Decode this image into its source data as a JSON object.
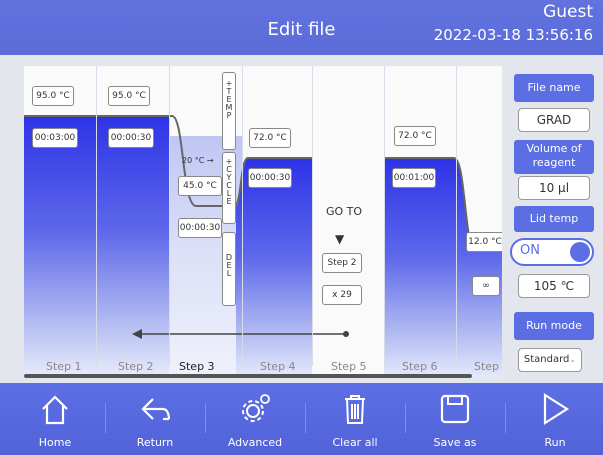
{
  "header": {
    "title": "Edit file",
    "user": "Guest",
    "datetime": "2022-03-18 13:56:16"
  },
  "steps": [
    {
      "label": "Step 1",
      "temp": "95.0 °C",
      "time": "00:03:00"
    },
    {
      "label": "Step 2",
      "temp": "95.0 °C",
      "time": "00:00:30"
    },
    {
      "label": "Step 3",
      "temp": "45.0 °C",
      "time": "00:00:30",
      "gradient": "20 °C →"
    },
    {
      "label": "Step 4",
      "temp": "72.0 °C",
      "time": "00:00:30"
    },
    {
      "label": "Step 5",
      "goto": "GO TO",
      "goto_step": "Step 2",
      "goto_count": "x 29"
    },
    {
      "label": "Step 6",
      "temp": "72.0 °C",
      "time": "00:01:00"
    },
    {
      "label": "Step",
      "temp": "12.0 °C",
      "time": "∞"
    }
  ],
  "vertical_menu": {
    "temp": "+TEMP",
    "cycle": "+CYCLE",
    "del": "DEL"
  },
  "sidebar": {
    "file_name_label": "File name",
    "file_name_value": "GRAD",
    "volume_label": "Volume of reagent",
    "volume_value": "10 μl",
    "lid_label": "Lid temp",
    "lid_toggle": "ON",
    "lid_value": "105 ℃",
    "run_mode_label": "Run mode",
    "run_mode_value": "Standard"
  },
  "footer": [
    "Home",
    "Return",
    "Advanced",
    "Clear all",
    "Save as",
    "Run"
  ]
}
